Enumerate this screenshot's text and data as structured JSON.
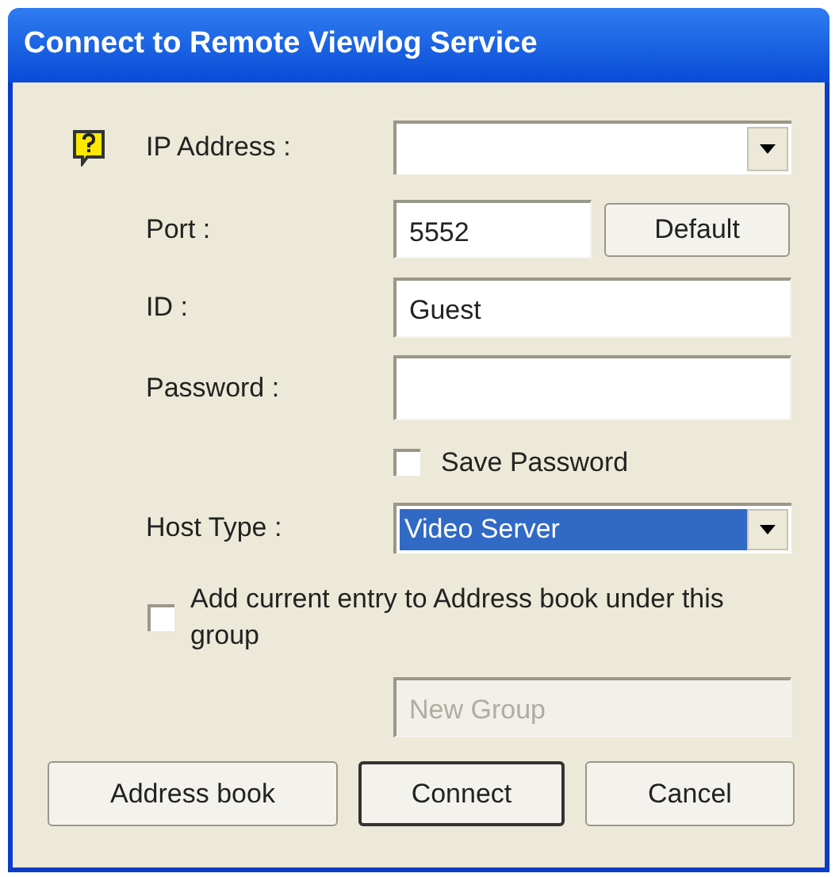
{
  "window": {
    "title": "Connect to Remote Viewlog Service"
  },
  "fields": [
    {
      "kind": "combo",
      "label": "IP Address :",
      "highlighted": false
    },
    {
      "kind": "text",
      "label": "Port :",
      "value": "5552",
      "button": "Default"
    },
    {
      "kind": "text",
      "label": "ID :",
      "value": "Guest"
    },
    {
      "kind": "text",
      "label": "Password :"
    }
  ],
  "save_password": {
    "label": "Save Password",
    "checked": false
  },
  "host_type": {
    "label": "Host Type :",
    "value": "Video Server",
    "highlighted": true
  },
  "add_to_address_book": {
    "label": "Add current entry to Address book under this group",
    "checked": false
  },
  "group_field": {
    "value": "New Group",
    "disabled": true
  },
  "buttons": [
    {
      "label": "Address book",
      "default": false
    },
    {
      "label": "Connect",
      "default": true
    },
    {
      "label": "Cancel",
      "default": false
    }
  ]
}
